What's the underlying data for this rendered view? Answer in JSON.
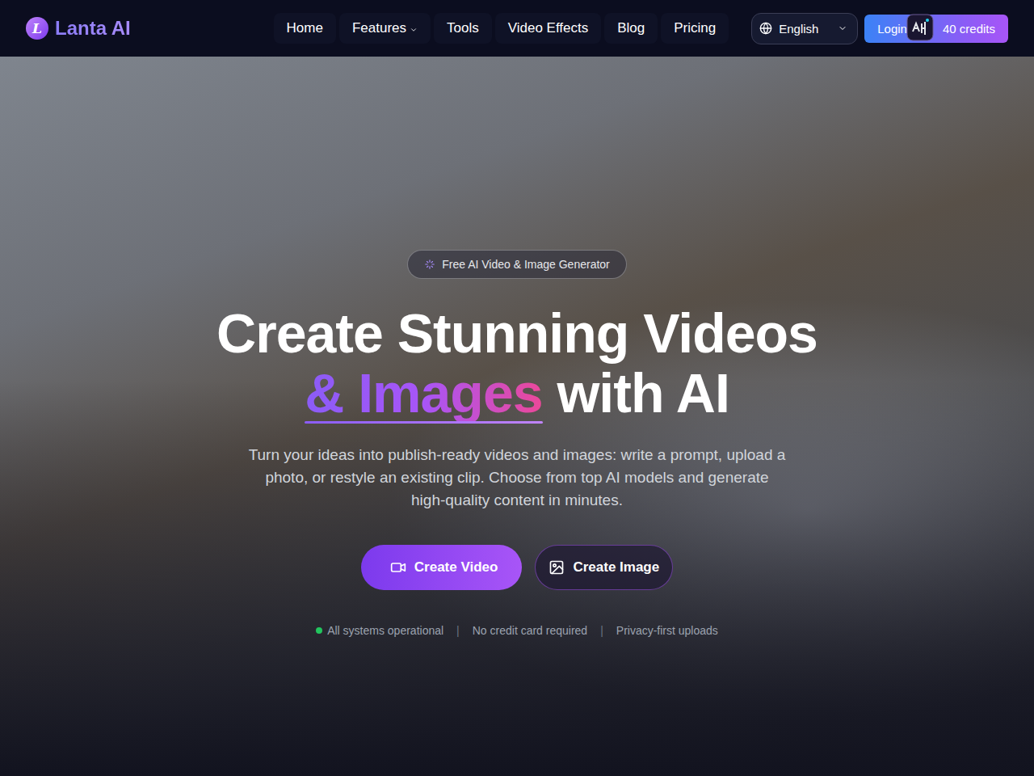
{
  "header": {
    "logo": {
      "letter": "L",
      "text": "Lanta AI"
    },
    "nav": [
      {
        "label": "Home",
        "dropdown": false
      },
      {
        "label": "Features",
        "dropdown": true
      },
      {
        "label": "Tools",
        "dropdown": false
      },
      {
        "label": "Video Effects",
        "dropdown": false
      },
      {
        "label": "Blog",
        "dropdown": false
      },
      {
        "label": "Pricing",
        "dropdown": false
      }
    ],
    "language": {
      "label": "English"
    },
    "login": "Login",
    "credits": "40 credits"
  },
  "hero": {
    "badge": "Free AI Video & Image Generator",
    "title_line1": "Create Stunning Videos",
    "title_highlight": "& Images",
    "title_rest": "with AI",
    "subtitle": "Turn your ideas into publish-ready videos and images: write a prompt, upload a photo, or restyle an existing clip. Choose from top AI models and generate high-quality content in minutes.",
    "buttons": [
      {
        "label": "Create Video",
        "kind": "primary"
      },
      {
        "label": "Create Image",
        "kind": "secondary"
      }
    ],
    "separator": "|",
    "trust": [
      {
        "label": "All systems operational",
        "dot": true,
        "color": "#22c55e"
      },
      {
        "label": "No credit card required",
        "dot": false,
        "color": "#9ca3af"
      },
      {
        "label": "Privacy-first uploads",
        "dot": false,
        "color": "#9ca3af"
      }
    ]
  }
}
